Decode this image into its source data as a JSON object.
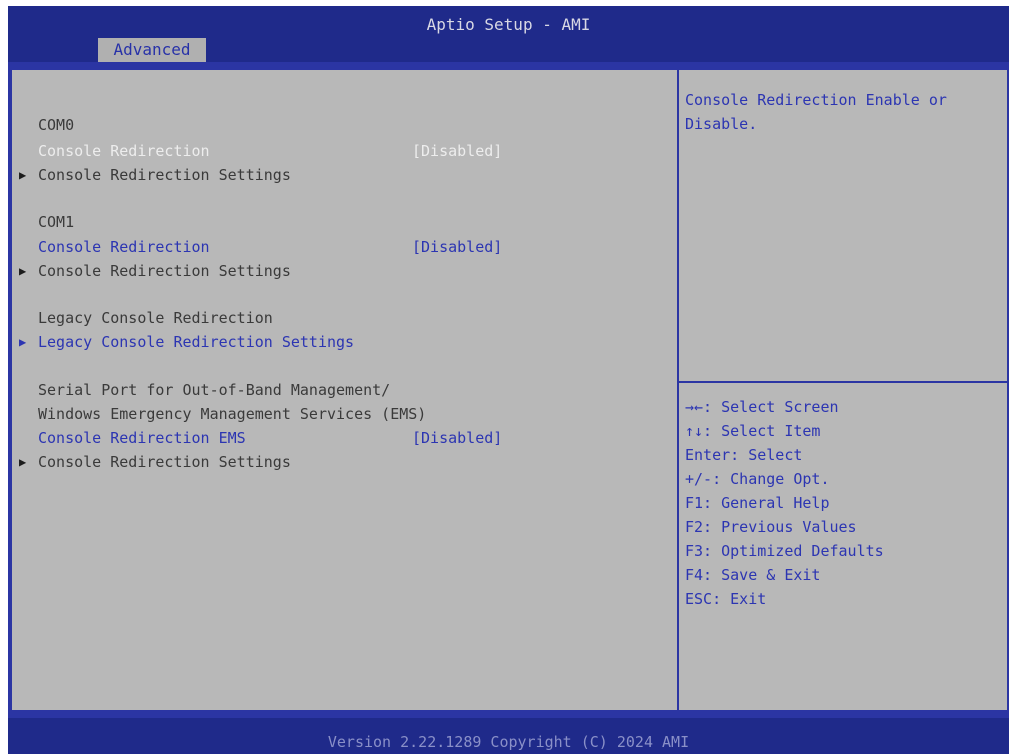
{
  "header": {
    "title": "Aptio Setup - AMI",
    "active_tab": "Advanced"
  },
  "menu": {
    "com0_heading": "COM0",
    "com0_redirection_label": "Console Redirection",
    "com0_redirection_value": "[Disabled]",
    "com0_settings_label": "Console Redirection Settings",
    "com1_heading": "COM1",
    "com1_redirection_label": "Console Redirection",
    "com1_redirection_value": "[Disabled]",
    "com1_settings_label": "Console Redirection Settings",
    "legacy_heading": "Legacy Console Redirection",
    "legacy_settings_label": "Legacy Console Redirection Settings",
    "ems_heading_line1": "Serial Port for Out-of-Band Management/",
    "ems_heading_line2": "Windows Emergency Management Services (EMS)",
    "ems_redirection_label": "Console Redirection EMS",
    "ems_redirection_value": "[Disabled]",
    "ems_settings_label": "Console Redirection Settings"
  },
  "help": {
    "description": "Console Redirection Enable or Disable.",
    "keys": [
      "→←: Select Screen",
      "↑↓: Select Item",
      "Enter: Select",
      "+/-: Change Opt.",
      "F1: General Help",
      "F2: Previous Values",
      "F3: Optimized Defaults",
      "F4: Save & Exit",
      "ESC: Exit"
    ]
  },
  "footer": {
    "version": "Version 2.22.1289 Copyright (C) 2024 AMI"
  },
  "icons": {
    "submenu_arrow": "submenu-arrow-icon"
  },
  "colors": {
    "frame_blue": "#2b35a3",
    "panel_gray": "#b8b8b8",
    "highlight_white": "#ededed",
    "accent_blue": "#2c35b2"
  }
}
